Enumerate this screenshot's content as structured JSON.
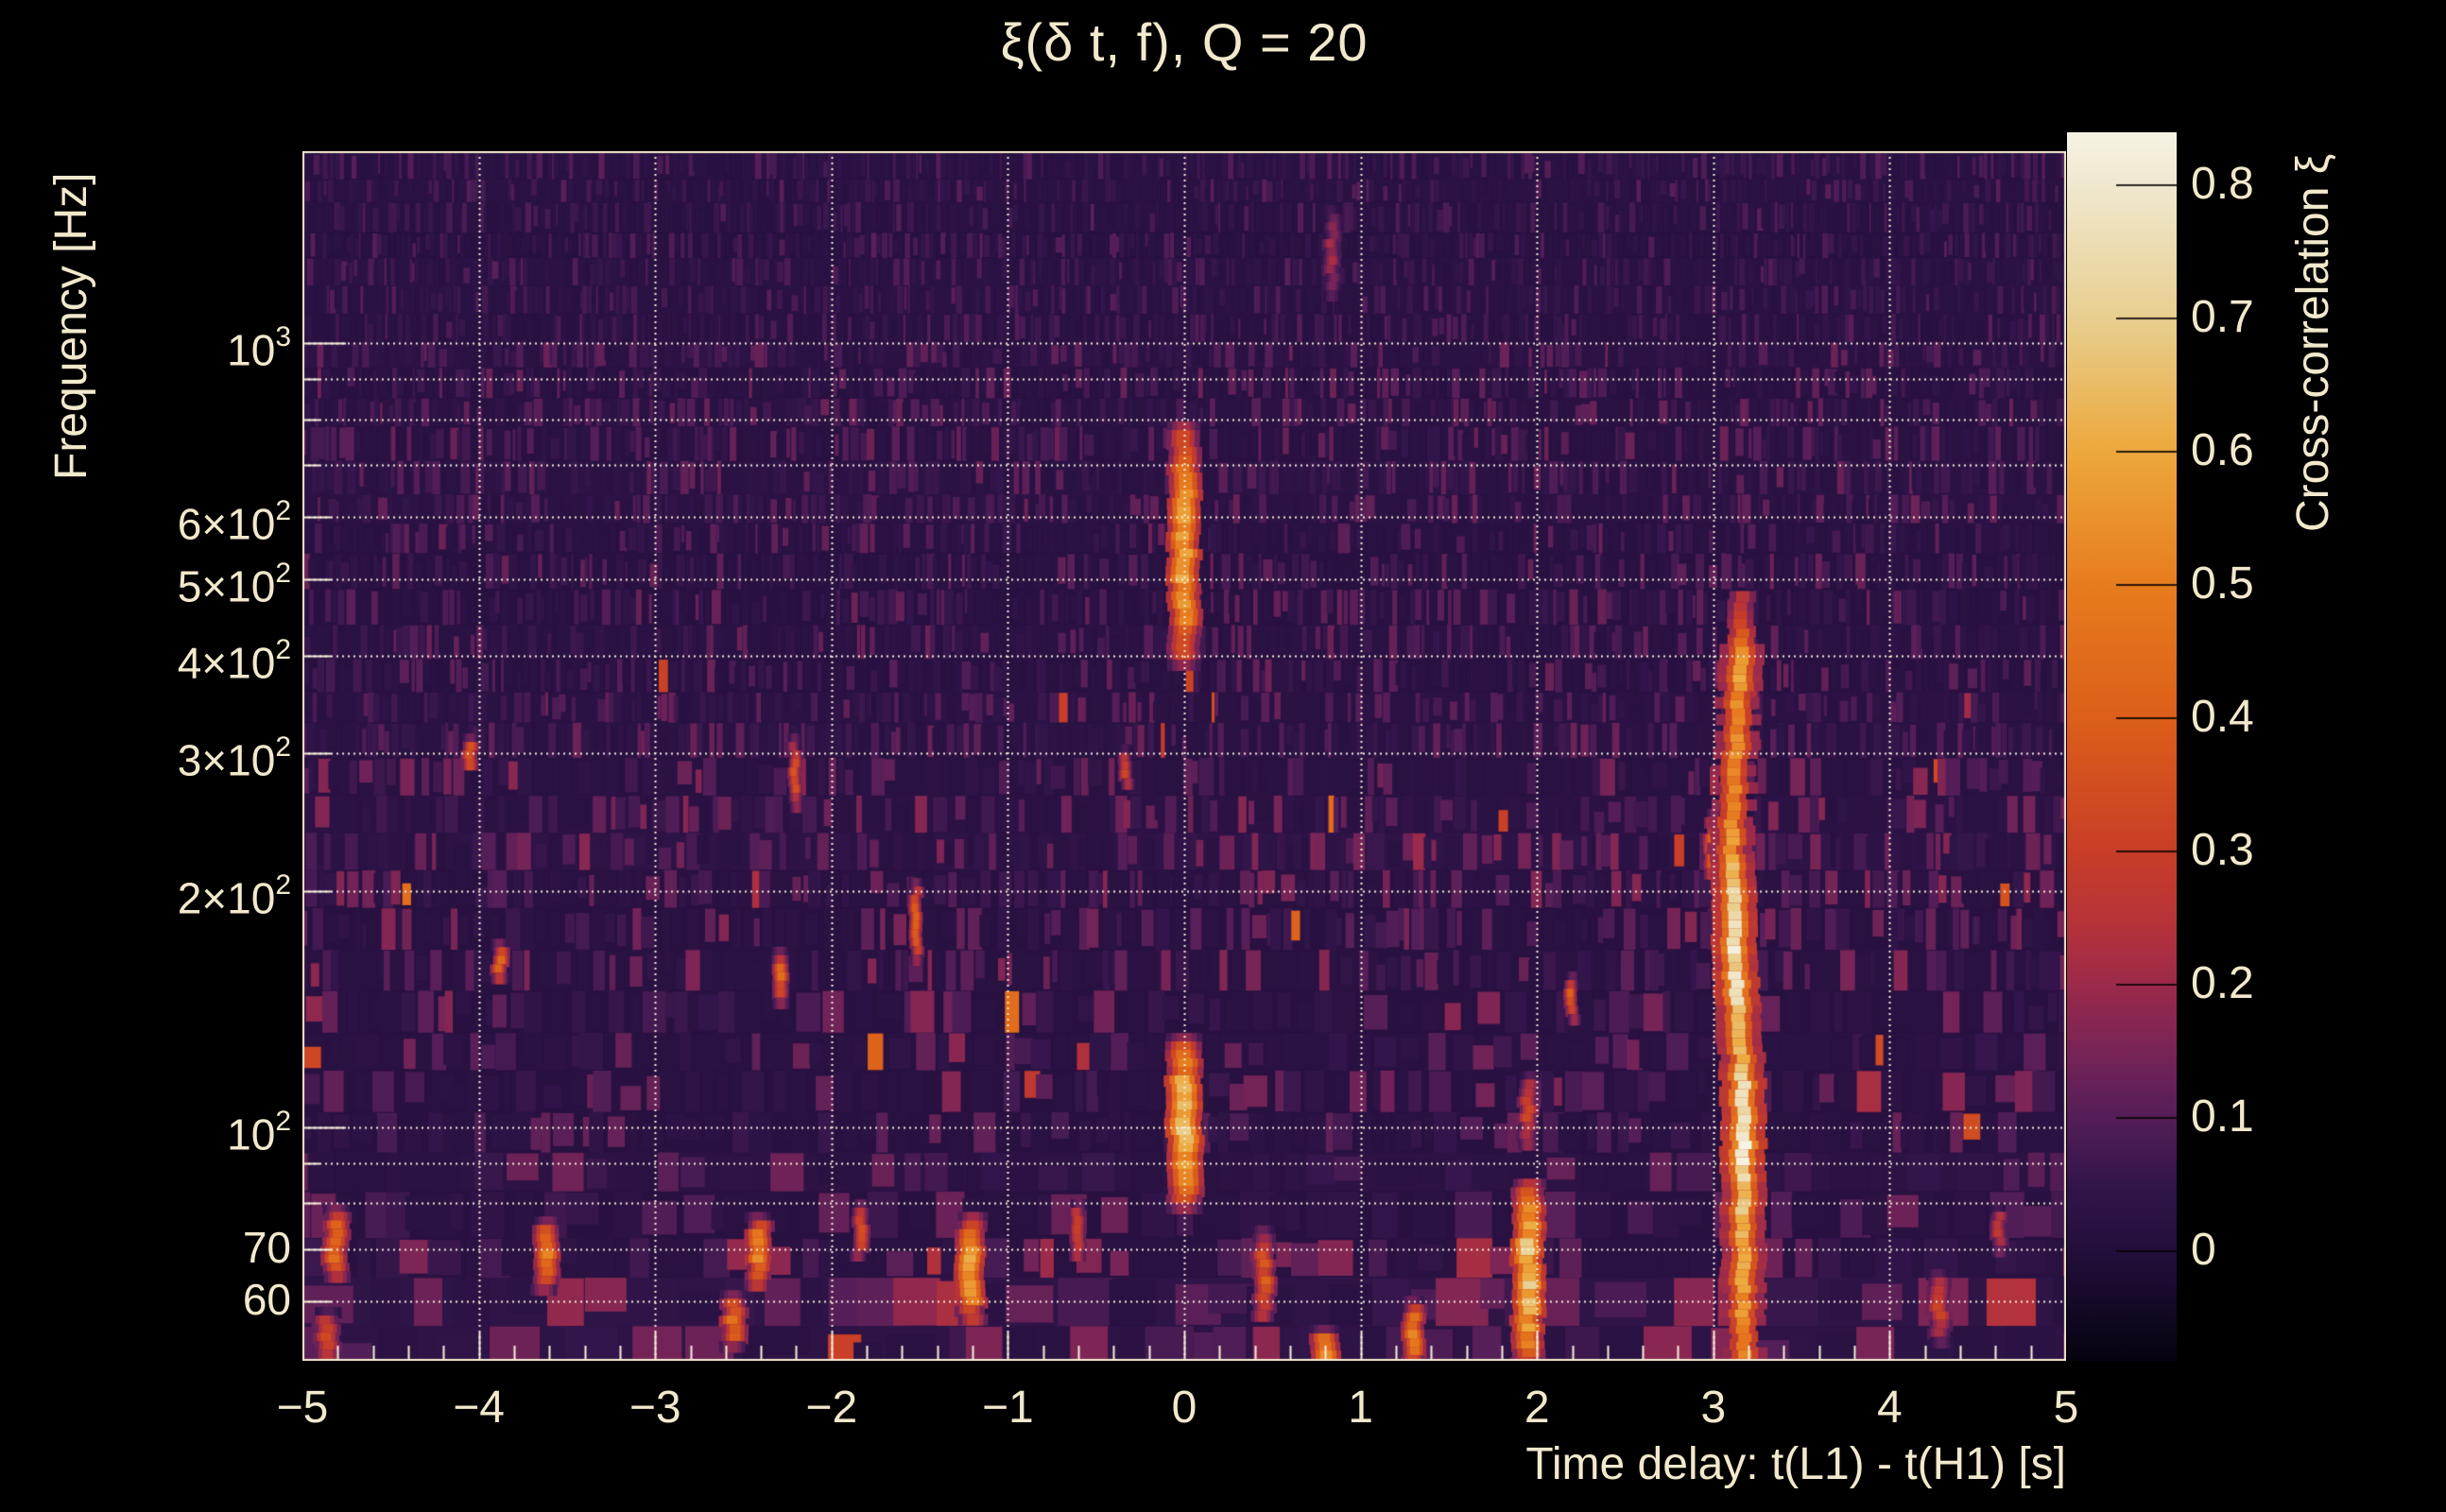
{
  "title": "ξ(δ t, f), Q = 20",
  "colors": {
    "background": "#000000",
    "text": "#f2e9cd",
    "grid": "#f6f0dc",
    "frame": "#f2e9cd",
    "plot_base": "#241136",
    "feature_hot": "#f7f4e4",
    "feature_orange": "#e77c1e"
  },
  "axes": {
    "x": {
      "label": "Time delay: t(L1) - t(H1) [s]",
      "min": -5,
      "max": 5,
      "minor_tick_step": 0.2,
      "ticks": [
        {
          "value": -5,
          "label": "−5"
        },
        {
          "value": -4,
          "label": "−4"
        },
        {
          "value": -3,
          "label": "−3"
        },
        {
          "value": -2,
          "label": "−2"
        },
        {
          "value": -1,
          "label": "−1"
        },
        {
          "value": 0,
          "label": "0"
        },
        {
          "value": 1,
          "label": "1"
        },
        {
          "value": 2,
          "label": "2"
        },
        {
          "value": 3,
          "label": "3"
        },
        {
          "value": 4,
          "label": "4"
        },
        {
          "value": 5,
          "label": "5"
        }
      ]
    },
    "y": {
      "label": "Frequency [Hz]",
      "scale": "log",
      "min_hz": 50.4,
      "max_hz": 1758,
      "ticks": [
        {
          "value": 1000,
          "base": "10",
          "exp": "3"
        },
        {
          "value": 600,
          "base": "6×10",
          "exp": "2"
        },
        {
          "value": 500,
          "base": "5×10",
          "exp": "2"
        },
        {
          "value": 400,
          "base": "4×10",
          "exp": "2"
        },
        {
          "value": 300,
          "base": "3×10",
          "exp": "2"
        },
        {
          "value": 200,
          "base": "2×10",
          "exp": "2"
        },
        {
          "value": 100,
          "base": "10",
          "exp": "2"
        },
        {
          "value": 70,
          "base": "70",
          "exp": ""
        },
        {
          "value": 60,
          "base": "60",
          "exp": ""
        }
      ],
      "gridlines_hz": [
        60,
        70,
        80,
        90,
        100,
        200,
        300,
        400,
        500,
        600,
        700,
        800,
        900,
        1000
      ],
      "labeled_values": [
        1000,
        600,
        500,
        400,
        300,
        200,
        100,
        70,
        60
      ]
    }
  },
  "colorbar": {
    "label": "Cross-correlation ξ",
    "value_top": 0.84,
    "value_bottom": -0.082,
    "ticks": [
      {
        "value": 0.8,
        "label": "0.8"
      },
      {
        "value": 0.7,
        "label": "0.7"
      },
      {
        "value": 0.6,
        "label": "0.6"
      },
      {
        "value": 0.5,
        "label": "0.5"
      },
      {
        "value": 0.4,
        "label": "0.4"
      },
      {
        "value": 0.3,
        "label": "0.3"
      },
      {
        "value": 0.2,
        "label": "0.2"
      },
      {
        "value": 0.1,
        "label": "0.1"
      },
      {
        "value": 0,
        "label": "0"
      }
    ],
    "stops": [
      {
        "v": -0.082,
        "color": "#060310"
      },
      {
        "v": 0.0,
        "color": "#230f3c"
      },
      {
        "v": 0.05,
        "color": "#32154a"
      },
      {
        "v": 0.1,
        "color": "#541e58"
      },
      {
        "v": 0.15,
        "color": "#782457"
      },
      {
        "v": 0.2,
        "color": "#9c2a4a"
      },
      {
        "v": 0.25,
        "color": "#b83438"
      },
      {
        "v": 0.3,
        "color": "#c83e28"
      },
      {
        "v": 0.4,
        "color": "#dc5f1a"
      },
      {
        "v": 0.5,
        "color": "#e77c1e"
      },
      {
        "v": 0.6,
        "color": "#eda83c"
      },
      {
        "v": 0.7,
        "color": "#e8cf8f"
      },
      {
        "v": 0.8,
        "color": "#f0e8cf"
      },
      {
        "v": 0.84,
        "color": "#f7f4e4"
      }
    ]
  },
  "chart_data": {
    "type": "heatmap",
    "title": "ξ(δ t, f), Q = 20",
    "xlabel": "Time delay: t(L1) - t(H1) [s]",
    "ylabel": "Frequency [Hz]",
    "colorbar_label": "Cross-correlation ξ",
    "x_range_s": [
      -5,
      5
    ],
    "y_range_hz": [
      50.4,
      1758
    ],
    "y_scale": "log",
    "value_range_xi": [
      -0.082,
      0.84
    ],
    "background_noise_xi": [
      0,
      0.12
    ],
    "noise_seed": 20,
    "grid": {
      "x_gridlines_s": [
        -4,
        -3,
        -2,
        -1,
        0,
        1,
        2,
        3,
        4
      ],
      "y_gridlines_hz": [
        60,
        70,
        80,
        90,
        100,
        200,
        300,
        400,
        500,
        600,
        700,
        800,
        900,
        1000
      ]
    },
    "features": [
      {
        "name": "streak-dt0-high-freq",
        "dt": 0.0,
        "f_lo": 395,
        "f_hi": 795,
        "peak_xi": 0.58,
        "width_s": 0.1
      },
      {
        "name": "streak-dt0-low-freq",
        "dt": 0.0,
        "f_lo": 80,
        "f_hi": 132,
        "peak_xi": 0.62,
        "width_s": 0.11
      },
      {
        "name": "blob-dt2",
        "dt": 1.95,
        "f_lo": 50,
        "f_hi": 86,
        "peak_xi": 0.66,
        "width_s": 0.1
      },
      {
        "name": "blob-dt-1.2",
        "dt": -1.21,
        "f_lo": 57,
        "f_hi": 78,
        "peak_xi": 0.55,
        "width_s": 0.09
      },
      {
        "name": "blob-dt-2.4",
        "dt": -2.41,
        "f_lo": 63,
        "f_hi": 78,
        "peak_xi": 0.5,
        "width_s": 0.08
      },
      {
        "name": "blob-dt-2.55-low",
        "dt": -2.55,
        "f_lo": 53,
        "f_hi": 62,
        "peak_xi": 0.42,
        "width_s": 0.08
      },
      {
        "name": "blob-dt-3.6",
        "dt": -3.62,
        "f_lo": 63,
        "f_hi": 77,
        "peak_xi": 0.48,
        "width_s": 0.08
      },
      {
        "name": "blob-dt-4.8",
        "dt": -4.81,
        "f_lo": 65,
        "f_hi": 80,
        "peak_xi": 0.45,
        "width_s": 0.08
      },
      {
        "name": "blob-dt-4.86-low",
        "dt": -4.86,
        "f_lo": 51,
        "f_hi": 59,
        "peak_xi": 0.32,
        "width_s": 0.08
      },
      {
        "name": "dot-dt-4.05-300hz",
        "dt": -4.05,
        "f_lo": 288,
        "f_hi": 318,
        "peak_xi": 0.4,
        "width_s": 0.05
      },
      {
        "name": "dot-dt-3.88-165hz",
        "dt": -3.88,
        "f_lo": 156,
        "f_hi": 174,
        "peak_xi": 0.45,
        "width_s": 0.05
      },
      {
        "name": "dot-dt-2.28-158hz",
        "dt": -2.28,
        "f_lo": 146,
        "f_hi": 170,
        "peak_xi": 0.4,
        "width_s": 0.05
      },
      {
        "name": "streak-dt-2.2-290hz",
        "dt": -2.21,
        "f_lo": 258,
        "f_hi": 318,
        "peak_xi": 0.34,
        "width_s": 0.04
      },
      {
        "name": "streak-dt3-230hz",
        "dt": 3.0,
        "f_lo": 210,
        "f_hi": 255,
        "peak_xi": 0.5,
        "width_s": 0.05
      },
      {
        "name": "blob-dt1.3-bottom",
        "dt": 1.3,
        "f_lo": 50,
        "f_hi": 61,
        "peak_xi": 0.46,
        "width_s": 0.07
      },
      {
        "name": "blob-dt0.8-bottom",
        "dt": 0.8,
        "f_lo": 50,
        "f_hi": 56,
        "peak_xi": 0.5,
        "width_s": 0.09
      },
      {
        "name": "blob-dt0.45",
        "dt": 0.45,
        "f_lo": 57,
        "f_hi": 75,
        "peak_xi": 0.36,
        "width_s": 0.07
      },
      {
        "name": "dot-dt-0.6",
        "dt": -0.6,
        "f_lo": 69,
        "f_hi": 81,
        "peak_xi": 0.34,
        "width_s": 0.05
      },
      {
        "name": "dot-dt-1.84",
        "dt": -1.84,
        "f_lo": 69,
        "f_hi": 81,
        "peak_xi": 0.34,
        "width_s": 0.05
      },
      {
        "name": "blob-dt4.3",
        "dt": 4.28,
        "f_lo": 54,
        "f_hi": 66,
        "peak_xi": 0.3,
        "width_s": 0.07
      },
      {
        "name": "faint-column-dt0.84-high",
        "dt": 0.84,
        "f_lo": 1150,
        "f_hi": 1500,
        "peak_xi": 0.2,
        "width_s": 0.05
      },
      {
        "name": "streak-dt-1.5-185hz",
        "dt": -1.52,
        "f_lo": 165,
        "f_hi": 208,
        "peak_xi": 0.4,
        "width_s": 0.04
      },
      {
        "name": "dot-dt-0.33-290hz",
        "dt": -0.33,
        "f_lo": 275,
        "f_hi": 308,
        "peak_xi": 0.3,
        "width_s": 0.04
      },
      {
        "name": "dot-dt2.2-148hz",
        "dt": 2.2,
        "f_lo": 138,
        "f_hi": 158,
        "peak_xi": 0.38,
        "width_s": 0.04
      },
      {
        "name": "streak-dt1.95-105hz",
        "dt": 1.95,
        "f_lo": 95,
        "f_hi": 118,
        "peak_xi": 0.3,
        "width_s": 0.06
      },
      {
        "name": "dot-dt4.6",
        "dt": 4.62,
        "f_lo": 70,
        "f_hi": 80,
        "peak_xi": 0.28,
        "width_s": 0.05
      },
      {
        "name": "sideblob-chirp-dt3.05",
        "dt": 3.05,
        "f_lo": 128,
        "f_hi": 162,
        "peak_xi": 0.45,
        "width_s": 0.04
      },
      {
        "name": "sideblob-chirp-dt3.22",
        "dt": 3.22,
        "f_lo": 350,
        "f_hi": 420,
        "peak_xi": 0.35,
        "width_s": 0.035
      }
    ],
    "chirp": {
      "name": "rising-frequency-chirp-dt3.1",
      "width_s": 0.07,
      "points": [
        {
          "dt": 3.17,
          "f": 50,
          "xi": 0.5
        },
        {
          "dt": 3.17,
          "f": 62,
          "xi": 0.55
        },
        {
          "dt": 3.17,
          "f": 78,
          "xi": 0.62
        },
        {
          "dt": 3.17,
          "f": 97,
          "xi": 0.8
        },
        {
          "dt": 3.17,
          "f": 110,
          "xi": 0.78
        },
        {
          "dt": 3.16,
          "f": 128,
          "xi": 0.6
        },
        {
          "dt": 3.14,
          "f": 148,
          "xi": 0.7
        },
        {
          "dt": 3.12,
          "f": 172,
          "xi": 0.76
        },
        {
          "dt": 3.12,
          "f": 195,
          "xi": 0.72
        },
        {
          "dt": 3.1,
          "f": 225,
          "xi": 0.58
        },
        {
          "dt": 3.11,
          "f": 262,
          "xi": 0.5
        },
        {
          "dt": 3.13,
          "f": 305,
          "xi": 0.52
        },
        {
          "dt": 3.14,
          "f": 345,
          "xi": 0.5
        },
        {
          "dt": 3.15,
          "f": 392,
          "xi": 0.6
        },
        {
          "dt": 3.16,
          "f": 425,
          "xi": 0.45
        },
        {
          "dt": 3.16,
          "f": 460,
          "xi": 0.3
        },
        {
          "dt": 3.17,
          "f": 495,
          "xi": 0.22
        }
      ]
    }
  }
}
